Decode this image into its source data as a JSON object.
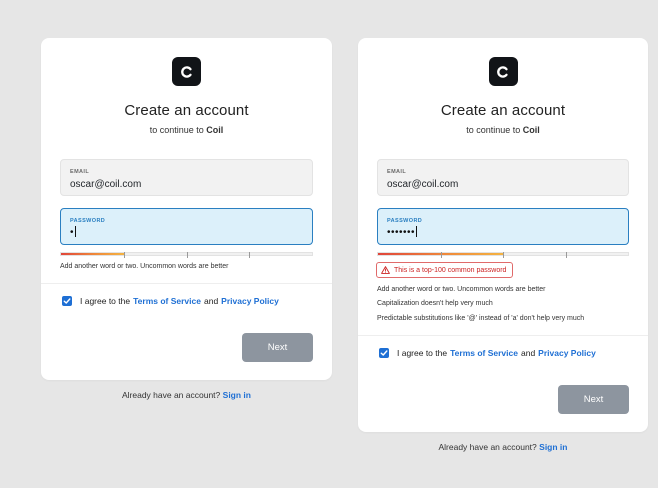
{
  "left_panel": {
    "title": "Create an account",
    "subtitle_prefix": "to continue to",
    "subtitle_app": "Coil",
    "email": {
      "label": "EMAIL",
      "value": "oscar@coil.com"
    },
    "password": {
      "label": "PASSWORD",
      "masked_value": "•",
      "strength": 0.25
    },
    "hints": [
      "Add another word or two. Uncommon words are better"
    ],
    "agree": {
      "prefix": "I agree to the",
      "terms": "Terms of Service",
      "and": "and",
      "privacy": "Privacy Policy",
      "checked": true
    },
    "next_label": "Next",
    "signin_prefix": "Already have an account?",
    "signin_link": "Sign in"
  },
  "right_panel": {
    "title": "Create an account",
    "subtitle_prefix": "to continue to",
    "subtitle_app": "Coil",
    "email": {
      "label": "EMAIL",
      "value": "oscar@coil.com"
    },
    "password": {
      "label": "PASSWORD",
      "masked_value": "•••••••",
      "strength": 0.5
    },
    "warning": "This is a top-100 common password",
    "hints": [
      "Add another word or two. Uncommon words are better",
      "Capitalization doesn't help very much",
      "Predictable substitutions like '@' instead of 'a' don't help very much"
    ],
    "agree": {
      "prefix": "I agree to the",
      "terms": "Terms of Service",
      "and": "and",
      "privacy": "Privacy Policy",
      "checked": true
    },
    "next_label": "Next",
    "signin_prefix": "Already have an account?",
    "signin_link": "Sign in"
  },
  "colors": {
    "accent": "#1e6fd4",
    "logo_bg": "#111418",
    "password_focus": "#2a7fc1",
    "warning": "#cc2222",
    "button_disabled": "#8d959f"
  },
  "icons": {
    "logo": "coil-logo-icon",
    "warning": "warning-triangle-icon",
    "check": "check-icon"
  }
}
